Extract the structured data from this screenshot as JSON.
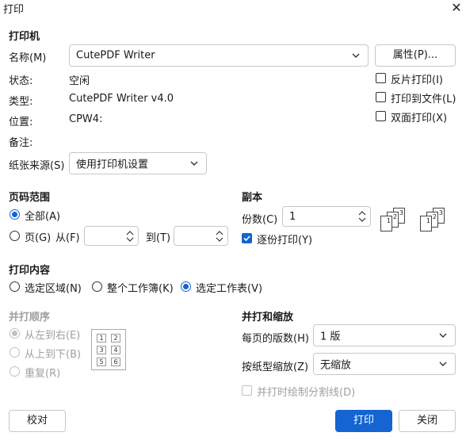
{
  "window": {
    "title": "打印"
  },
  "printer": {
    "section": "打印机",
    "name_label": "名称(M)",
    "name_value": "CutePDF Writer",
    "properties_button": "属性(P)...",
    "status_label": "状态:",
    "status_value": "空闲",
    "type_label": "类型:",
    "type_value": "CutePDF Writer v4.0",
    "location_label": "位置:",
    "location_value": "CPW4:",
    "comment_label": "备注:",
    "paper_source_label": "纸张来源(S)",
    "paper_source_value": "使用打印机设置",
    "reverse_print": "反片打印(I)",
    "print_to_file": "打印到文件(L)",
    "duplex": "双面打印(X)"
  },
  "page_range": {
    "section": "页码范围",
    "all": "全部(A)",
    "pages": "页(G)",
    "from": "从(F)",
    "to": "到(T)",
    "from_value": "",
    "to_value": ""
  },
  "copies": {
    "section": "副本",
    "count_label": "份数(C)",
    "count_value": "1",
    "collate": "逐份打印(Y)"
  },
  "print_what": {
    "section": "打印内容",
    "selection": "选定区域(N)",
    "entire_workbook": "整个工作簿(K)",
    "active_sheets": "选定工作表(V)"
  },
  "print_order": {
    "section": "并打顺序",
    "left_to_right": "从左到右(E)",
    "top_to_bottom": "从上到下(B)",
    "repeat": "重复(R)",
    "grid_labels": [
      "1",
      "2",
      "3",
      "4",
      "5",
      "6"
    ]
  },
  "zoom": {
    "section": "并打和缩放",
    "pages_per_sheet_label": "每页的版数(H)",
    "pages_per_sheet_value": "1 版",
    "scale_to_paper_label": "按纸型缩放(Z)",
    "scale_to_paper_value": "无缩放",
    "draw_borders": "并打时绘制分割线(D)"
  },
  "footer": {
    "proof_button": "校对",
    "print_button": "打印",
    "close_button": "关闭"
  },
  "colors": {
    "accent": "#1464d2",
    "disabled": "#a0a0a0"
  }
}
